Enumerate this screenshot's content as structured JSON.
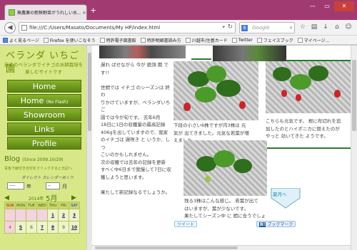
{
  "browser": {
    "tab_title": "無農薬の新鮮野菜がうれしい水...",
    "tab_close": "×",
    "new_tab": "+",
    "url": "file:///C:/Users/Masato/Documents/My HP/index.html",
    "search_placeholder": "Google",
    "search_engine_letter": "8",
    "win_min": "—",
    "win_max": "▭",
    "win_close": "✕",
    "bookmarks": [
      {
        "label": "よく見るページ"
      },
      {
        "label": "Firefox を使いこなそう"
      },
      {
        "label": "特許電子図書館"
      },
      {
        "label": "特許明細書読み方"
      },
      {
        "label": "川越市/住基カード"
      },
      {
        "label": "Twitter"
      },
      {
        "label": "フェイスブック"
      },
      {
        "label": "マイページ..."
      }
    ]
  },
  "sidebar": {
    "site_title": "ベランダ いちご園",
    "tagline": "自宅のベランダでイチゴの水耕栽培を楽しむサイトです",
    "menu": [
      {
        "label": "Home",
        "sub": ""
      },
      {
        "label": "Home",
        "sub": "(No Flash)"
      },
      {
        "label": "Showroom",
        "sub": ""
      },
      {
        "label": "Links",
        "sub": ""
      },
      {
        "label": "Profile",
        "sub": ""
      }
    ],
    "blog_title": "Blog",
    "blog_since": "(Since 2009.10/29)",
    "blog_sub": "青色下線付き日付をクリックすると日記へ",
    "cal_direct": "ダイレクト カレンダーめくり",
    "cal_year_sel": "----",
    "cal_year_lbl": "年",
    "cal_month_sel": "--",
    "cal_month_lbl": "月",
    "cal_year": "2014年",
    "cal_month": "5月",
    "cal_prev": "◀",
    "cal_next": "▶",
    "weekdays": [
      "SUN",
      "MON",
      "TUE",
      "WED",
      "THU",
      "FRI",
      "SAT"
    ],
    "weeks": [
      [
        "",
        "",
        "",
        "",
        "1",
        "2",
        "3"
      ],
      [
        "4",
        "5",
        "6",
        "7",
        "8",
        "9",
        "10"
      ]
    ]
  },
  "content": {
    "col1_text": [
      "遅れ ばせながら 今が 絶頂 期 です!!",
      "",
      "世間では イチゴ のシーズンは 終わ",
      "りかけていますが、ベランダいちご",
      "園では今が旬です。 去年6月",
      "18日に1日の収穫量の最高記録",
      "406gを出していますので、我家",
      "のイチゴは 遅咲き と いうか、しつ",
      "こいのかもしれません。",
      "次の収穫では去年の記録を更新",
      "すべく中6日まで我慢して7日に収",
      "穫しようと思います。",
      "",
      "果たして新記録なるでしょうか。"
    ],
    "caption1": [
      "下段の小さい6株ですが内3株は 元",
      "気が 出てきました。元気な若葉が増",
      "えました。"
    ],
    "caption2": [
      "こちらも元気です。 根に布切れを追",
      "加したのとハイポニカに替えたのが",
      "やっと 効いてきた ようです。"
    ],
    "caption3": [
      "残る3株はこんな感じ。 若葉が出て",
      "はいますが、葉が少ないです。",
      "果たしてシーズン中 に 間に合うでしょ"
    ],
    "arrow_label": "夏月へ",
    "tweet": "ツイート",
    "bookmark": "ブックマーク",
    "hatena_b": "B!"
  }
}
